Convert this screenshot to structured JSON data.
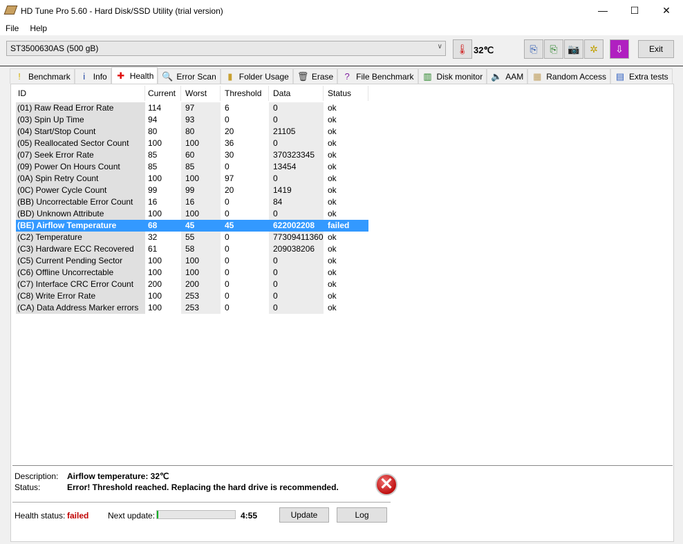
{
  "window": {
    "title": "HD Tune Pro 5.60 - Hard Disk/SSD Utility (trial version)",
    "minimize": "—",
    "maximize": "☐",
    "close": "✕"
  },
  "menu": [
    {
      "label": "File"
    },
    {
      "label": "Help"
    }
  ],
  "toolbar": {
    "drive": "ST3500630AS (500 gB)",
    "temperature": "32℃",
    "exit_label": "Exit"
  },
  "tabs": [
    {
      "label": "Benchmark",
      "icon": "!",
      "color": "#d4b000"
    },
    {
      "label": "Info",
      "icon": "i",
      "color": "#1a3fa0"
    },
    {
      "label": "Health",
      "icon": "✚",
      "color": "#e01010"
    },
    {
      "label": "Error Scan",
      "icon": "🔍",
      "color": "#208020"
    },
    {
      "label": "Folder Usage",
      "icon": "▮",
      "color": "#c8a030"
    },
    {
      "label": "Erase",
      "icon": "🗑",
      "color": "#333"
    },
    {
      "label": "File Benchmark",
      "icon": "?",
      "color": "#8020a0"
    },
    {
      "label": "Disk monitor",
      "icon": "▥",
      "color": "#208020"
    },
    {
      "label": "AAM",
      "icon": "🔈",
      "color": "#a08000"
    },
    {
      "label": "Random Access",
      "icon": "▦",
      "color": "#c0a060"
    },
    {
      "label": "Extra tests",
      "icon": "▤",
      "color": "#3060c0"
    }
  ],
  "active_tab": "Health",
  "table": {
    "headers": [
      "ID",
      "Current",
      "Worst",
      "Threshold",
      "Data",
      "Status"
    ],
    "rows": [
      [
        "(01) Raw Read Error Rate",
        "114",
        "97",
        "6",
        "0",
        "ok"
      ],
      [
        "(03) Spin Up Time",
        "94",
        "93",
        "0",
        "0",
        "ok"
      ],
      [
        "(04) Start/Stop Count",
        "80",
        "80",
        "20",
        "21105",
        "ok"
      ],
      [
        "(05) Reallocated Sector Count",
        "100",
        "100",
        "36",
        "0",
        "ok"
      ],
      [
        "(07) Seek Error Rate",
        "85",
        "60",
        "30",
        "370323345",
        "ok"
      ],
      [
        "(09) Power On Hours Count",
        "85",
        "85",
        "0",
        "13454",
        "ok"
      ],
      [
        "(0A) Spin Retry Count",
        "100",
        "100",
        "97",
        "0",
        "ok"
      ],
      [
        "(0C) Power Cycle Count",
        "99",
        "99",
        "20",
        "1419",
        "ok"
      ],
      [
        "(BB) Uncorrectable Error Count",
        "16",
        "16",
        "0",
        "84",
        "ok"
      ],
      [
        "(BD) Unknown Attribute",
        "100",
        "100",
        "0",
        "0",
        "ok"
      ],
      [
        "(BE) Airflow Temperature",
        "68",
        "45",
        "45",
        "622002208",
        "failed"
      ],
      [
        "(C2) Temperature",
        "32",
        "55",
        "0",
        "77309411360",
        "ok"
      ],
      [
        "(C3) Hardware ECC Recovered",
        "61",
        "58",
        "0",
        "209038206",
        "ok"
      ],
      [
        "(C5) Current Pending Sector",
        "100",
        "100",
        "0",
        "0",
        "ok"
      ],
      [
        "(C6) Offline Uncorrectable",
        "100",
        "100",
        "0",
        "0",
        "ok"
      ],
      [
        "(C7) Interface CRC Error Count",
        "200",
        "200",
        "0",
        "0",
        "ok"
      ],
      [
        "(C8) Write Error Rate",
        "100",
        "253",
        "0",
        "0",
        "ok"
      ],
      [
        "(CA) Data Address Marker errors",
        "100",
        "253",
        "0",
        "0",
        "ok"
      ]
    ],
    "selected_row": 10
  },
  "details": {
    "description_label": "Description:",
    "description": "Airflow temperature: 32℃",
    "status_label": "Status:",
    "status": "Error! Threshold reached. Replacing the hard drive is recommended."
  },
  "footer": {
    "health_label": "Health status:",
    "health": "failed",
    "health_color": "#c00000",
    "next_update_label": "Next update:",
    "progress_percent": 2,
    "countdown": "4:55",
    "update_label": "Update",
    "log_label": "Log"
  }
}
